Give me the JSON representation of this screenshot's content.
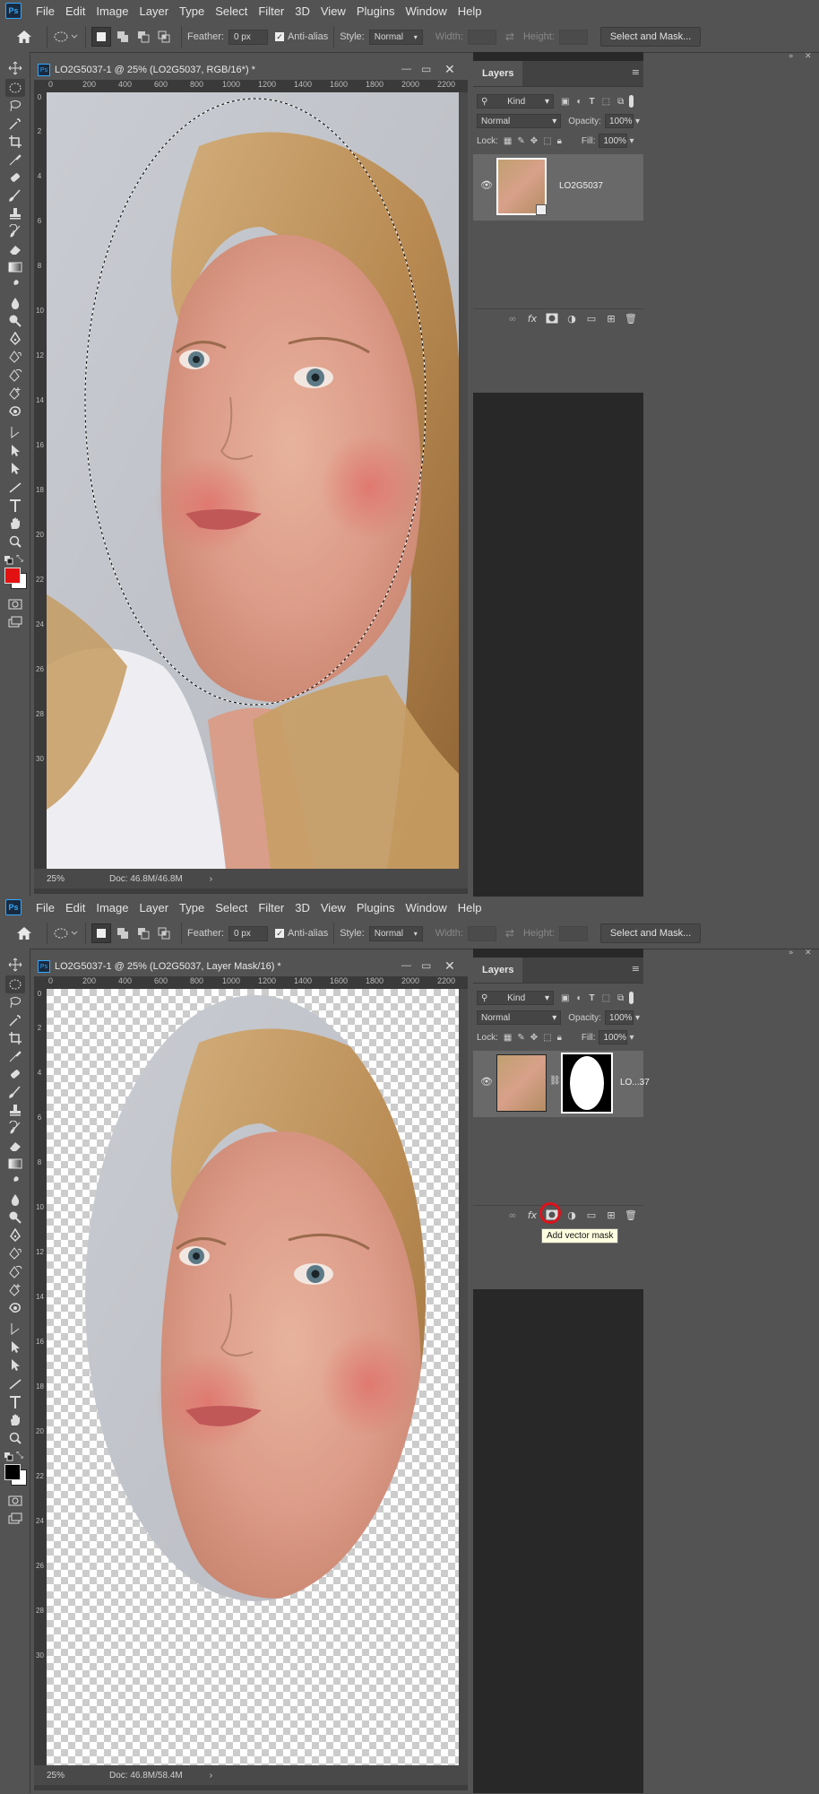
{
  "menu": [
    "File",
    "Edit",
    "Image",
    "Layer",
    "Type",
    "Select",
    "Filter",
    "3D",
    "View",
    "Plugins",
    "Window",
    "Help"
  ],
  "app_logo": "Ps",
  "options": {
    "feather_label": "Feather:",
    "feather_value": "0 px",
    "antialias_label": "Anti-alias",
    "style_label": "Style:",
    "style_value": "Normal",
    "width_label": "Width:",
    "height_label": "Height:",
    "select_mask_button": "Select and Mask..."
  },
  "ruler": {
    "h_ticks": [
      "0",
      "200",
      "400",
      "600",
      "800",
      "1000",
      "1200",
      "1400",
      "1600",
      "1800",
      "2000",
      "2200"
    ],
    "v_ticks": [
      "0",
      "2",
      "4",
      "6",
      "8",
      "10",
      "12",
      "14",
      "16",
      "18",
      "20",
      "22",
      "24",
      "26",
      "28",
      "30"
    ]
  },
  "layers_panel": {
    "tab": "Layers",
    "kind": "Kind",
    "blend_mode": "Normal",
    "opacity_label": "Opacity:",
    "opacity_value": "100%",
    "lock_label": "Lock:",
    "fill_label": "Fill:",
    "fill_value": "100%"
  },
  "screens": [
    {
      "doc_title": "LO2G5037-1 @ 25% (LO2G5037, RGB/16*) *",
      "layer_name": "LO2G5037",
      "zoom": "25%",
      "doc_info": "Doc: 46.8M/46.8M",
      "foreground_color": "#e31212",
      "background_color": "#ffffff"
    },
    {
      "doc_title": "LO2G5037-1 @ 25% (LO2G5037, Layer Mask/16) *",
      "layer_name": "LO...37",
      "zoom": "25%",
      "doc_info": "Doc: 46.8M/58.4M",
      "foreground_color": "#000000",
      "background_color": "#ffffff",
      "tooltip": "Add vector mask"
    }
  ],
  "colors": {
    "ui_bg": "#535353",
    "highlight_ring": "#e0111b",
    "selection_marquee": "#000000"
  }
}
